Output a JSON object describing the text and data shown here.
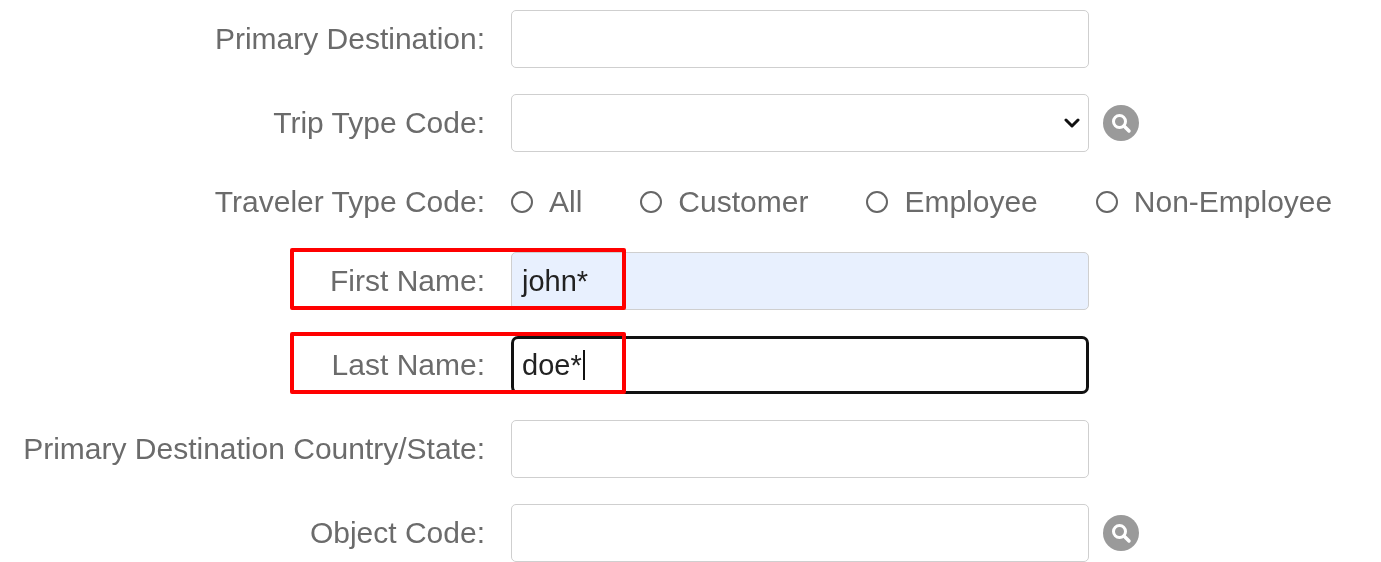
{
  "fields": [
    {
      "kind": "text",
      "label": "Primary Destination:",
      "autofilled": false,
      "focused": false,
      "highlighted": false,
      "lookup": false
    },
    {
      "kind": "select",
      "label": "Trip Type Code:",
      "autofilled": false,
      "focused": false,
      "highlighted": false,
      "lookup": true
    },
    {
      "kind": "radio",
      "label": "Traveler Type Code:",
      "options": [
        {
          "label": "All",
          "selected": false
        },
        {
          "label": "Customer",
          "selected": false
        },
        {
          "label": "Employee",
          "selected": false
        },
        {
          "label": "Non-Employee",
          "selected": false
        }
      ]
    },
    {
      "kind": "text",
      "label": "First Name:",
      "value": "john*",
      "autofilled": true,
      "focused": false,
      "highlighted": true,
      "lookup": false
    },
    {
      "kind": "text",
      "label": "Last Name:",
      "value": "doe*",
      "autofilled": false,
      "focused": true,
      "highlighted": true,
      "lookup": false
    },
    {
      "kind": "text",
      "label": "Primary Destination Country/State:",
      "autofilled": false,
      "focused": false,
      "highlighted": false,
      "lookup": false
    },
    {
      "kind": "text",
      "label": "Object Code:",
      "autofilled": false,
      "focused": false,
      "highlighted": false,
      "lookup": true
    }
  ]
}
